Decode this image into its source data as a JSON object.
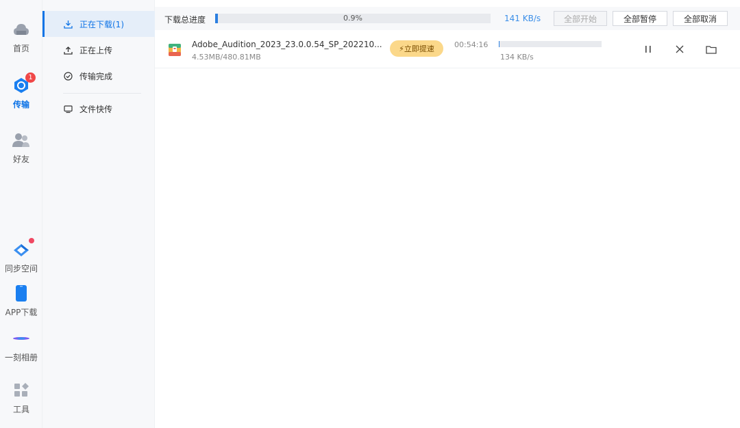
{
  "rail": {
    "items": [
      {
        "label": "首页",
        "icon": "cloud-icon"
      },
      {
        "label": "传输",
        "icon": "transfer-icon",
        "badge": "1",
        "active": true
      },
      {
        "label": "好友",
        "icon": "friends-icon"
      },
      {
        "label": "同步空间",
        "icon": "sync-space-icon"
      },
      {
        "label": "APP下载",
        "icon": "phone-icon"
      },
      {
        "label": "一刻相册",
        "icon": "album-icon"
      },
      {
        "label": "工具",
        "icon": "tools-icon"
      }
    ]
  },
  "subnav": {
    "items": [
      {
        "label": "正在下载(1)",
        "icon": "download-icon"
      },
      {
        "label": "正在上传",
        "icon": "upload-icon"
      },
      {
        "label": "传输完成",
        "icon": "check-circle-icon"
      },
      {
        "label": "文件快传",
        "icon": "monitor-icon"
      }
    ]
  },
  "toolbar": {
    "progress_label": "下载总进度",
    "progress_percent": 0.9,
    "progress_text": "0.9%",
    "speed": "141 KB/s",
    "start_all": "全部开始",
    "pause_all": "全部暂停",
    "cancel_all": "全部取消"
  },
  "downloads": [
    {
      "name": "Adobe_Audition_2023_23.0.0.54_SP_202210...",
      "size": "4.53MB/480.81MB",
      "boost_label": "⚡立即提速",
      "eta": "00:54:16",
      "progress_percent": 0.9,
      "speed": "134 KB/s"
    }
  ],
  "colors": {
    "accent": "#0f74e6",
    "badge": "#f04848",
    "boost": "#fbd88a"
  }
}
